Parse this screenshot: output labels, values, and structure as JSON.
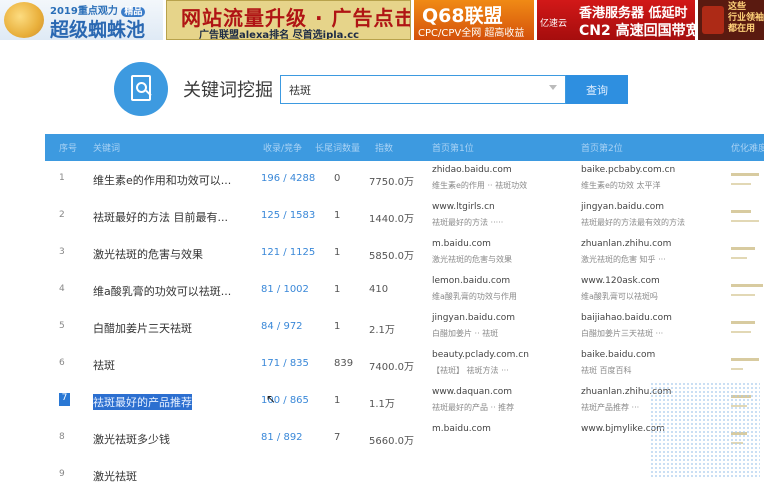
{
  "ads": {
    "logo": {
      "line1_year": "2019",
      "line1_text": "重点观力",
      "line1_badge": "精品",
      "line2": "超级蜘蛛池"
    },
    "traffic": {
      "line1": "网站流量升级 · 广告点击",
      "line2": "广告联盟alexa排名  尽首选ipla.cc"
    },
    "q68": {
      "line1": "Q68联盟",
      "line2": "CPC/CPV全网 超高收益"
    },
    "cn2": {
      "brand": "亿速云",
      "line1": "香港服务器 低延时",
      "line2": "CN2 高速回国带宽"
    },
    "side": {
      "lines": [
        "这些",
        "行业领袖",
        "都在用"
      ]
    }
  },
  "tool": {
    "title": "关键词挖掘",
    "search_value": "祛斑",
    "search_placeholder": "",
    "search_button": "查询"
  },
  "table": {
    "headers": [
      "序号",
      "关键词",
      "收录/竞争",
      "长尾词数量",
      "指数",
      "首页第1位",
      "首页第2位",
      "优化难度"
    ],
    "rows": [
      {
        "idx": "1",
        "kw": "维生素e的作用和功效可以...",
        "inc": "196 / 4288",
        "len": "0",
        "index": "7750.0万",
        "d1": "zhidao.baidu.com",
        "t1": "维生素e的作用 ·· 祛斑功效",
        "d2": "baike.pcbaby.com.cn",
        "t2": "维生素e的功效 太平洋",
        "bar1": 0.7,
        "bar2": 0.5,
        "selected": false
      },
      {
        "idx": "2",
        "kw": "祛斑最好的方法 目前最有...",
        "inc": "125 / 1583",
        "len": "1",
        "index": "1440.0万",
        "d1": "www.ltgirls.cn",
        "t1": "祛斑最好的方法 ·····",
        "d2": "jingyan.baidu.com",
        "t2": "祛斑最好的方法最有效的方法",
        "bar1": 0.5,
        "bar2": 0.7,
        "selected": false
      },
      {
        "idx": "3",
        "kw": "激光祛斑的危害与效果",
        "inc": "121 / 1125",
        "len": "1",
        "index": "5850.0万",
        "d1": "m.baidu.com",
        "t1": "激光祛斑的危害与效果",
        "d2": "zhuanlan.zhihu.com",
        "t2": "激光祛斑的危害 知乎 ···",
        "bar1": 0.6,
        "bar2": 0.4,
        "selected": false
      },
      {
        "idx": "4",
        "kw": "维a酸乳膏的功效可以祛斑...",
        "inc": "81 / 1002",
        "len": "1",
        "index": "410",
        "d1": "lemon.baidu.com",
        "t1": "维a酸乳膏的功效与作用",
        "d2": "www.120ask.com",
        "t2": "维a酸乳膏可以祛斑吗",
        "bar1": 0.8,
        "bar2": 0.6,
        "selected": false
      },
      {
        "idx": "5",
        "kw": "白醋加姜片三天祛斑",
        "inc": "84 / 972",
        "len": "1",
        "index": "2.1万",
        "d1": "jingyan.baidu.com",
        "t1": "白醋加姜片 ·· 祛斑",
        "d2": "baijiahao.baidu.com",
        "t2": "白醋加姜片三天祛斑 ···",
        "bar1": 0.6,
        "bar2": 0.5,
        "selected": false
      },
      {
        "idx": "6",
        "kw": "祛斑",
        "inc": "171 / 835",
        "len": "839",
        "index": "7400.0万",
        "d1": "beauty.pclady.com.cn",
        "t1": "【祛斑】 祛斑方法 ···",
        "d2": "baike.baidu.com",
        "t2": "祛斑 百度百科",
        "bar1": 0.7,
        "bar2": 0.3,
        "selected": false
      },
      {
        "idx": "7",
        "kw": "祛斑最好的产品推荐",
        "inc": "100 / 865",
        "len": "1",
        "index": "1.1万",
        "d1": "www.daquan.com",
        "t1": "祛斑最好的产品 ·· 推荐",
        "d2": "zhuanlan.zhihu.com",
        "t2": "祛斑产品推荐 ···",
        "bar1": 0.5,
        "bar2": 0.4,
        "selected": true
      },
      {
        "idx": "8",
        "kw": "激光祛斑多少钱",
        "inc": "81 / 892",
        "len": "7",
        "index": "5660.0万",
        "d1": "m.baidu.com",
        "t1": "",
        "d2": "www.bjmylike.com",
        "t2": "",
        "bar1": 0.4,
        "bar2": 0.3,
        "selected": false
      },
      {
        "idx": "9",
        "kw": "激光祛斑",
        "inc": "",
        "len": "",
        "index": "",
        "d1": "",
        "t1": "",
        "d2": "",
        "t2": "",
        "bar1": 0,
        "bar2": 0,
        "selected": false
      }
    ]
  },
  "colors": {
    "accent": "#3d9ae0",
    "header_text": "#a9d2f4",
    "link": "#3a88d8",
    "selected": "#2c6fd0"
  }
}
